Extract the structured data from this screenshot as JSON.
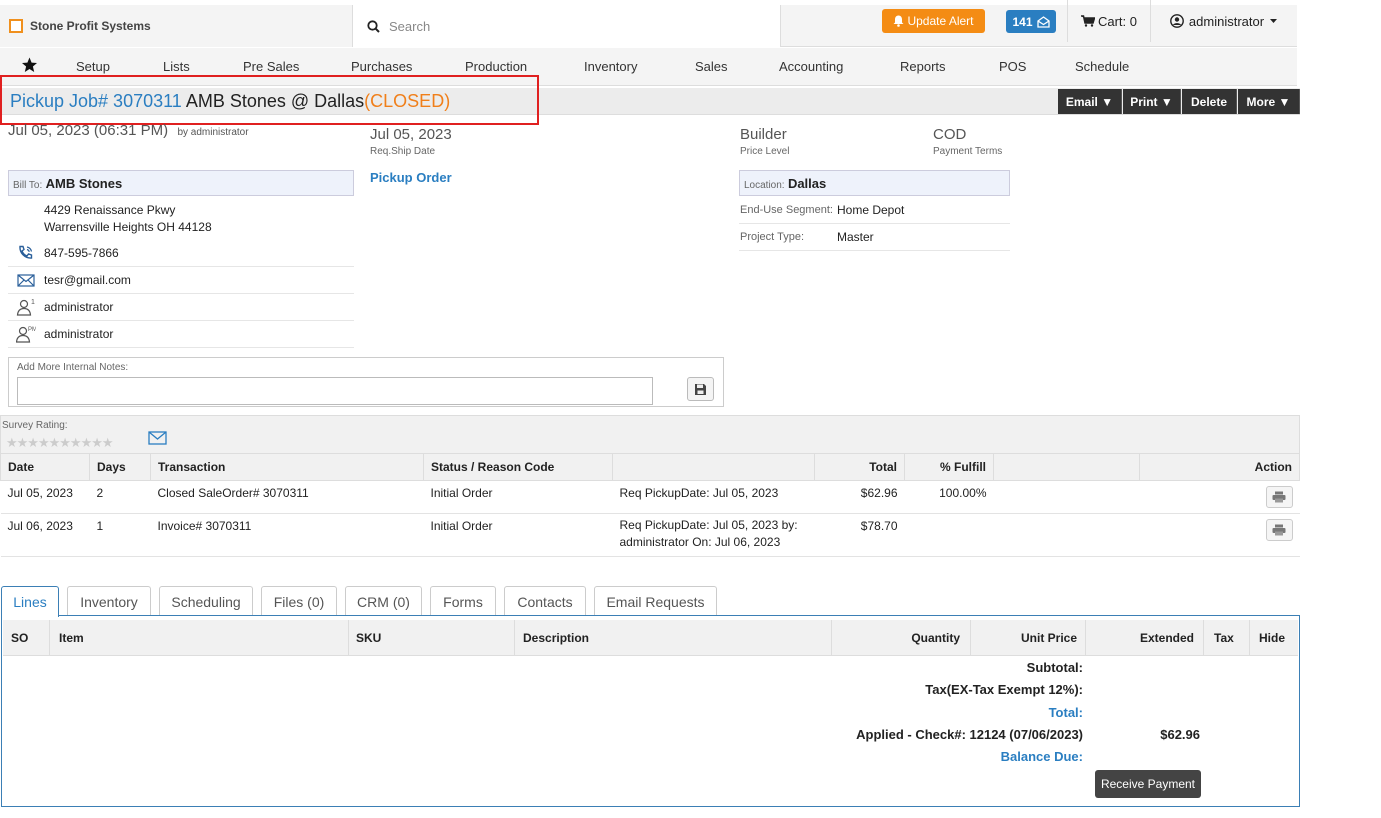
{
  "header": {
    "brand": "Stone Profit Systems",
    "search_placeholder": "Search",
    "update_alert": "Update Alert",
    "message_count": "141",
    "cart_label": "Cart: 0",
    "user": "administrator"
  },
  "nav": [
    "Setup",
    "Lists",
    "Pre Sales",
    "Purchases",
    "Production",
    "Inventory",
    "Sales",
    "Accounting",
    "Reports",
    "POS",
    "Schedule"
  ],
  "title": {
    "job": "Pickup Job# 3070311",
    "customer": " AMB Stones @ Dallas",
    "status": "(CLOSED)"
  },
  "actions": {
    "email": "Email ▼",
    "print": "Print ▼",
    "delete": "Delete",
    "more": "More ▼"
  },
  "info": {
    "created": "Jul 05, 2023 (06:31 PM)",
    "created_by": "by administrator",
    "ship_date": "Jul 05, 2023",
    "ship_date_label": "Req.Ship Date",
    "order_type": "Pickup Order",
    "price_level": "Builder",
    "price_level_label": "Price Level",
    "payment_terms": "COD",
    "payment_terms_label": "Payment Terms",
    "bill_to_label": "Bill To:",
    "bill_to": "AMB Stones",
    "address1": "4429 Renaissance Pkwy",
    "address2": "Warrensville Heights OH 44128",
    "phone": "847-595-7866",
    "email": "tesr@gmail.com",
    "rep1": "administrator",
    "rep2": "administrator",
    "location_label": "Location:",
    "location": "Dallas",
    "segment_label": "End-Use Segment:",
    "segment": "Home Depot",
    "project_type_label": "Project Type:",
    "project_type": "Master"
  },
  "notes": {
    "label": "Add More Internal Notes:",
    "value": ""
  },
  "survey_label": "Survey Rating:",
  "transactions": {
    "headers": [
      "Date",
      "Days",
      "Transaction",
      "Status / Reason Code",
      "",
      "Total",
      "% Fulfill",
      "",
      "Action"
    ],
    "rows": [
      {
        "date": "Jul 05, 2023",
        "days": "2",
        "transaction": "Closed SaleOrder# 3070311",
        "status": "Initial Order",
        "note": "Req PickupDate: Jul 05, 2023",
        "total": "$62.96",
        "fulfill": "100.00%"
      },
      {
        "date": "Jul 06, 2023",
        "days": "1",
        "transaction": "Invoice# 3070311",
        "status": "Initial Order",
        "note": "Req PickupDate: Jul 05, 2023 by: administrator On: Jul 06, 2023",
        "total": "$78.70",
        "fulfill": ""
      }
    ]
  },
  "tabs": [
    "Lines",
    "Inventory",
    "Scheduling",
    "Files (0)",
    "CRM (0)",
    "Forms",
    "Contacts",
    "Email Requests"
  ],
  "lines": {
    "headers": [
      "SO",
      "Item",
      "SKU",
      "Description",
      "Quantity",
      "Unit Price",
      "Extended",
      "Tax",
      "Hide"
    ],
    "subtotal_label": "Subtotal:",
    "tax_label": "Tax(EX-Tax Exempt  12%):",
    "total_label": "Total:",
    "applied_label": "Applied - Check#: 12124 (07/06/2023)",
    "applied_amount": "$62.96",
    "balance_label": "Balance Due:",
    "receive_payment": "Receive Payment"
  },
  "colors": {
    "accent": "#2a7ec1",
    "alert": "#f48c14",
    "closed": "#f07f1a",
    "highlight": "#e02020"
  }
}
